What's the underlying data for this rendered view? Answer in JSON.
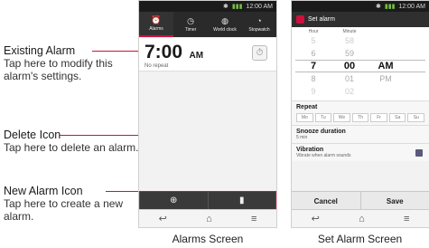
{
  "callouts": {
    "existing_alarm": {
      "title": "Existing Alarm",
      "desc": "Tap here to modify this alarm's settings."
    },
    "delete_icon": {
      "title": "Delete Icon",
      "desc": "Tap here to delete an alarm."
    },
    "new_alarm_icon": {
      "title": "New Alarm Icon",
      "desc": "Tap here to create a new alarm."
    }
  },
  "status_bar": {
    "time": "12:00 AM"
  },
  "alarms_screen": {
    "tabs": [
      {
        "label": "Alarms",
        "icon": "alarm-clock-icon"
      },
      {
        "label": "Timer",
        "icon": "timer-icon"
      },
      {
        "label": "World clock",
        "icon": "globe-icon"
      },
      {
        "label": "Stopwatch",
        "icon": "stopwatch-icon"
      }
    ],
    "alarm": {
      "time": "7:00",
      "ampm": "AM",
      "repeat": "No repeat"
    },
    "actions": {
      "new": "new-alarm-icon",
      "delete": "delete-icon"
    },
    "caption": "Alarms Screen"
  },
  "set_alarm_screen": {
    "title": "Set alarm",
    "picker": {
      "hour_label": "Hour",
      "minute_label": "Minute",
      "rows": [
        {
          "hour": "5",
          "minute": "58",
          "ampm": ""
        },
        {
          "hour": "6",
          "minute": "59",
          "ampm": ""
        },
        {
          "hour": "7",
          "minute": "00",
          "ampm": "AM"
        },
        {
          "hour": "8",
          "minute": "01",
          "ampm": "PM"
        },
        {
          "hour": "9",
          "minute": "02",
          "ampm": ""
        }
      ]
    },
    "repeat": {
      "title": "Repeat",
      "days": [
        "Mo",
        "Tu",
        "We",
        "Th",
        "Fr",
        "Sa",
        "Su"
      ]
    },
    "snooze": {
      "title": "Snooze duration",
      "value": "5 min"
    },
    "vibration": {
      "title": "Vibration",
      "desc": "Vibrate when alarm sounds",
      "checked": true
    },
    "buttons": {
      "cancel": "Cancel",
      "save": "Save"
    },
    "caption": "Set Alarm Screen"
  },
  "colors": {
    "accent": "#d0103a",
    "bar": "#3a3a3a"
  }
}
